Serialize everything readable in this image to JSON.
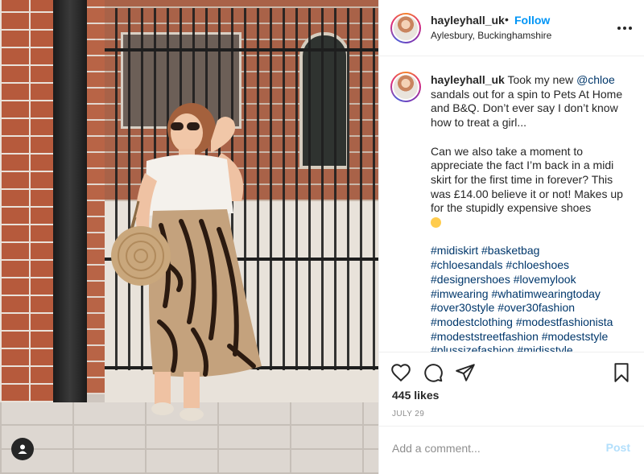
{
  "post": {
    "username": "hayleyhall_uk",
    "separator": "•",
    "follow_label": "Follow",
    "location": "Aylesbury, Buckinghamshire",
    "more_icon": "more-options-icon"
  },
  "caption": {
    "username": "hayleyhall_uk",
    "text_1": "Took my new",
    "mention": "@chloe",
    "text_2": "sandals out for a spin to Pets At Home and B&Q. Don’t ever say I don’t know how to treat a girl...",
    "paragraph_2": "Can we also take a moment to appreciate the fact I’m back in a midi skirt for the first time in forever? This was £14.00 believe it or not! Makes up for the stupidly expensive shoes",
    "emoji": "upside-down-face-emoji",
    "hashtags": [
      "#midiskirt",
      "#basketbag",
      "#chloesandals",
      "#chloeshoes",
      "#designershoes",
      "#lovemylook",
      "#imwearing",
      "#whatimwearingtoday",
      "#over30style",
      "#over30fashion",
      "#modestclothing",
      "#modestfashionista",
      "#modeststreetfashion",
      "#modeststyle",
      "#plussizefashion",
      "#midisstyle"
    ]
  },
  "actions": {
    "like_icon": "heart-icon",
    "comment_icon": "comment-icon",
    "share_icon": "paper-plane-icon",
    "save_icon": "bookmark-icon",
    "likes": "445 likes",
    "date": "JULY 29"
  },
  "comment": {
    "placeholder": "Add a comment...",
    "post_label": "Post"
  },
  "colors": {
    "accent": "#0095f6",
    "link": "#00376b",
    "post_disabled": "#b2dffc",
    "muted": "#8e8e8e"
  }
}
